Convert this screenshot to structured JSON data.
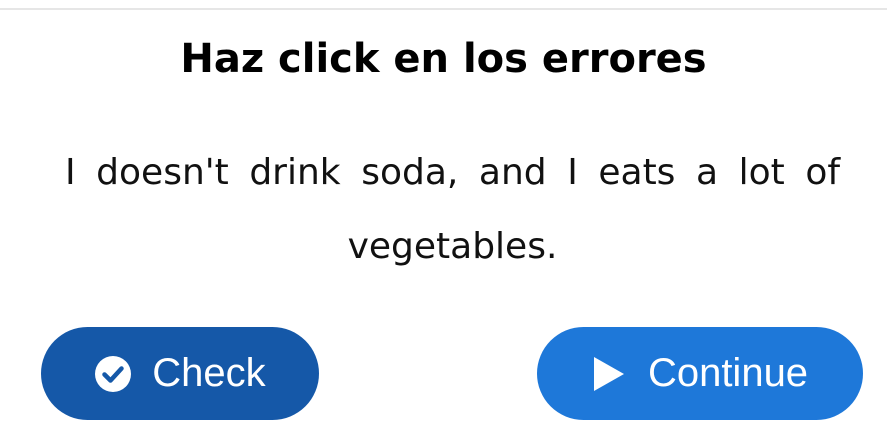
{
  "prompt": {
    "title": "Haz click en los errores"
  },
  "sentence": {
    "words": [
      "I",
      "doesn't",
      "drink",
      "soda",
      ",",
      "and",
      "I",
      "eats",
      "a",
      "lot",
      "of",
      "vegetables",
      "."
    ]
  },
  "actions": {
    "check_label": "Check",
    "check_icon": "check-circle-icon",
    "continue_label": "Continue",
    "continue_icon": "play-icon"
  },
  "colors": {
    "check_button": "#1558a8",
    "continue_button": "#1e78d9",
    "text": "#111111"
  }
}
